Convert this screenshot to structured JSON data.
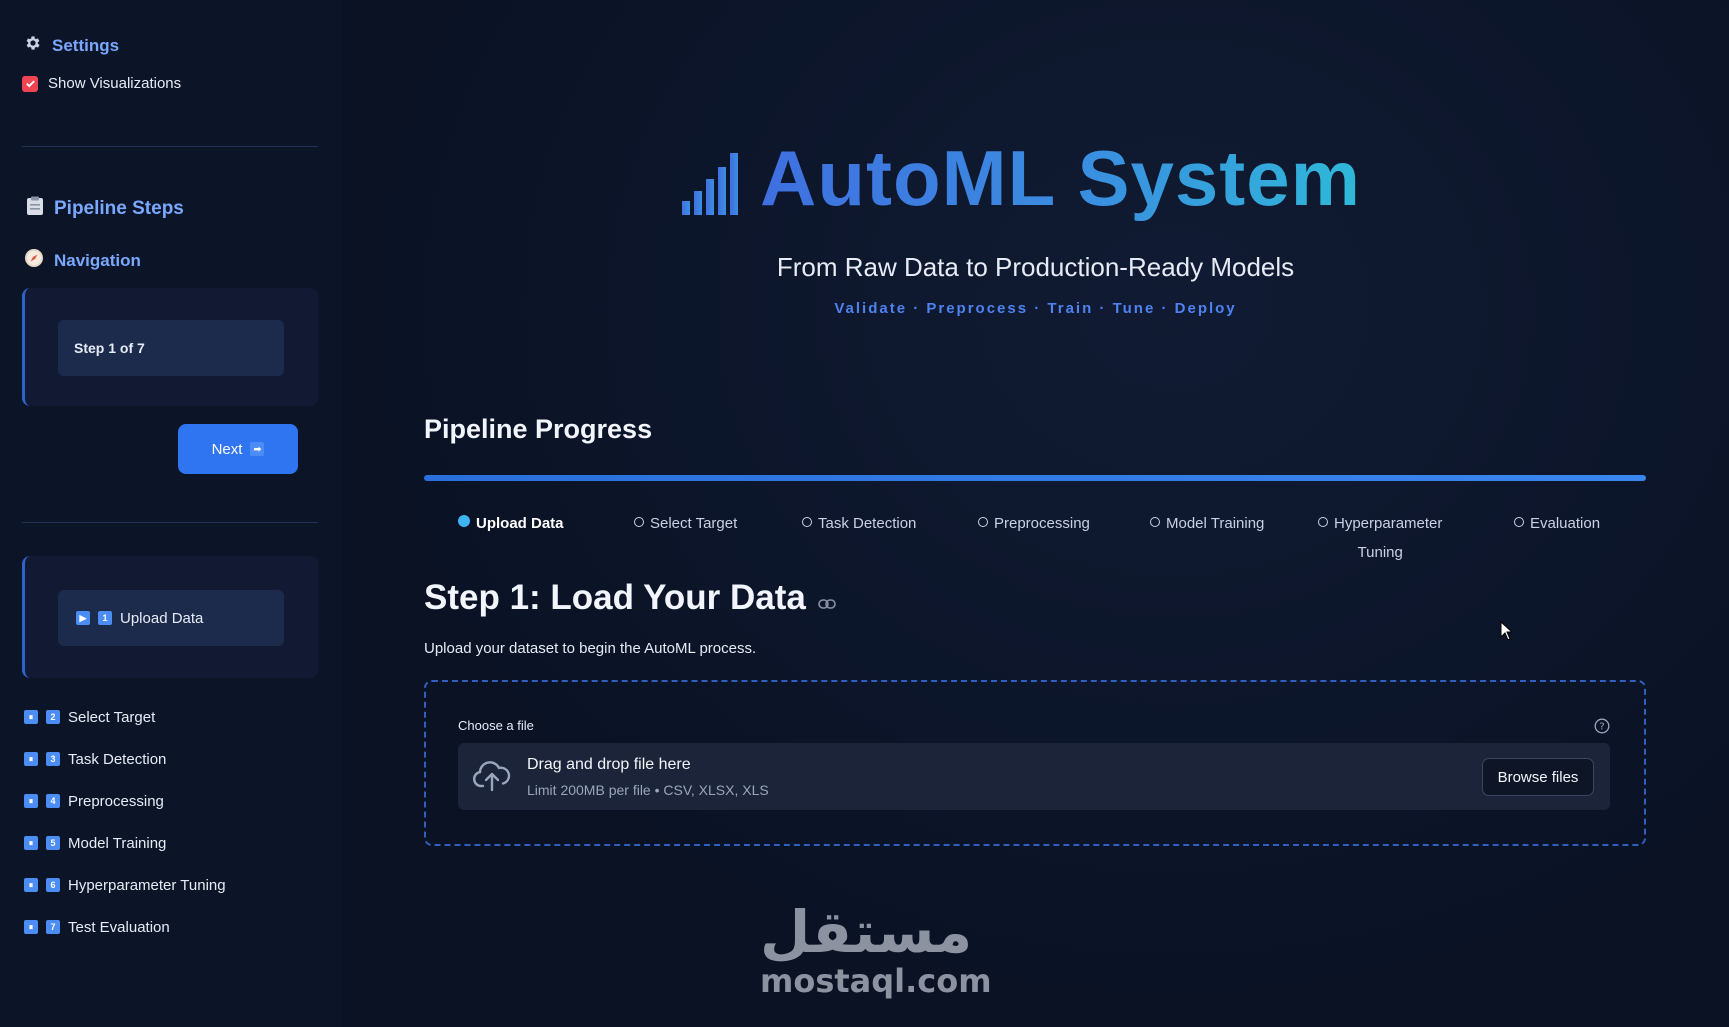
{
  "sidebar": {
    "settings_label": "Settings",
    "show_visualizations_label": "Show Visualizations",
    "show_visualizations_checked": true,
    "pipeline_steps_label": "Pipeline Steps",
    "navigation_label": "Navigation",
    "step_indicator": "Step 1 of 7",
    "next_label": "Next",
    "active_step": {
      "number": "1",
      "label": "Upload Data"
    },
    "steps": [
      {
        "number": "2",
        "label": "Select Target"
      },
      {
        "number": "3",
        "label": "Task Detection"
      },
      {
        "number": "4",
        "label": "Preprocessing"
      },
      {
        "number": "5",
        "label": "Model Training"
      },
      {
        "number": "6",
        "label": "Hyperparameter Tuning"
      },
      {
        "number": "7",
        "label": "Test Evaluation"
      }
    ]
  },
  "header": {
    "title": "AutoML System",
    "subtitle": "From Raw Data to Production-Ready Models",
    "tagline": "Validate · Preprocess · Train · Tune · Deploy"
  },
  "progress": {
    "heading": "Pipeline Progress",
    "fraction": 1.0,
    "stages": [
      {
        "label": "Upload Data",
        "active": true
      },
      {
        "label": "Select Target",
        "active": false
      },
      {
        "label": "Task Detection",
        "active": false
      },
      {
        "label": "Preprocessing",
        "active": false
      },
      {
        "label": "Model Training",
        "active": false
      },
      {
        "label": "Hyperparameter",
        "label2": "Tuning",
        "active": false
      },
      {
        "label": "Evaluation",
        "active": false
      }
    ]
  },
  "step": {
    "title": "Step 1: Load Your Data",
    "description": "Upload your dataset to begin the AutoML process."
  },
  "uploader": {
    "label": "Choose a file",
    "drop_title": "Drag and drop file here",
    "limit_text": "Limit 200MB per file • CSV, XLSX, XLS",
    "browse_label": "Browse files"
  },
  "watermark": {
    "arabic": "مستقل",
    "latin": "mostaql.com"
  },
  "colors": {
    "accent": "#2f74f0",
    "title_start": "#3f6fe0",
    "title_end": "#2fb8d8",
    "checkbox": "#ef4452",
    "active_dot": "#3fb4f5"
  }
}
